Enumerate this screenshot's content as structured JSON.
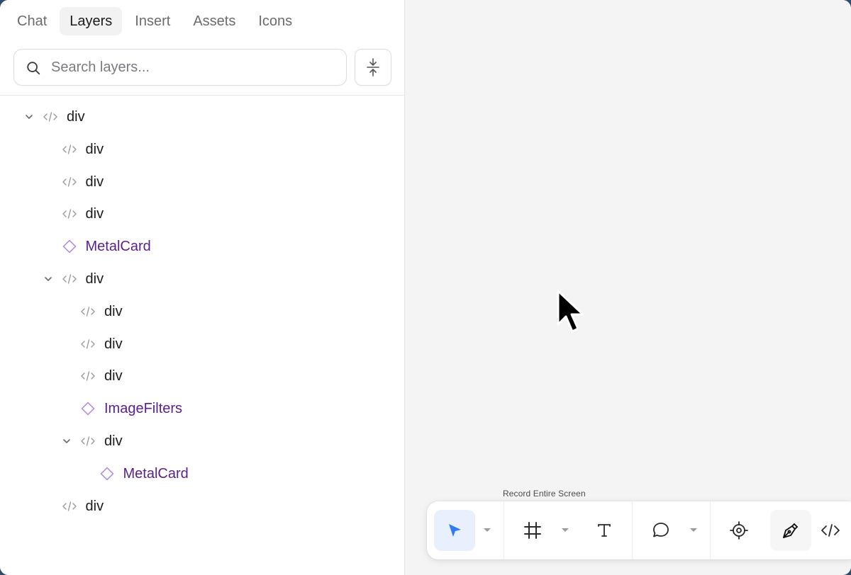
{
  "tabs": [
    {
      "label": "Chat",
      "active": false
    },
    {
      "label": "Layers",
      "active": true
    },
    {
      "label": "Insert",
      "active": false
    },
    {
      "label": "Assets",
      "active": false
    },
    {
      "label": "Icons",
      "active": false
    }
  ],
  "search": {
    "placeholder": "Search layers..."
  },
  "layers": [
    {
      "label": "div",
      "kind": "element",
      "expanded": true
    },
    {
      "label": "div",
      "kind": "element"
    },
    {
      "label": "div",
      "kind": "element"
    },
    {
      "label": "div",
      "kind": "element"
    },
    {
      "label": "MetalCard",
      "kind": "component"
    },
    {
      "label": "div",
      "kind": "element",
      "expanded": true
    },
    {
      "label": "div",
      "kind": "element"
    },
    {
      "label": "div",
      "kind": "element"
    },
    {
      "label": "div",
      "kind": "element"
    },
    {
      "label": "ImageFilters",
      "kind": "component"
    },
    {
      "label": "div",
      "kind": "element",
      "expanded": true
    },
    {
      "label": "MetalCard",
      "kind": "component"
    },
    {
      "label": "div",
      "kind": "element"
    }
  ],
  "toolbar": {
    "tooltip": "Record Entire Screen",
    "tools": [
      {
        "icon": "pointer-icon",
        "active": true
      },
      {
        "icon": "frame-icon"
      },
      {
        "icon": "text-icon"
      },
      {
        "icon": "comment-icon"
      },
      {
        "icon": "target-icon"
      },
      {
        "icon": "pen-icon"
      },
      {
        "icon": "code-icon"
      }
    ]
  },
  "colors": {
    "accent": "#2f7cf6",
    "component": "#5a1f8c",
    "component_icon": "#b28ad8"
  }
}
